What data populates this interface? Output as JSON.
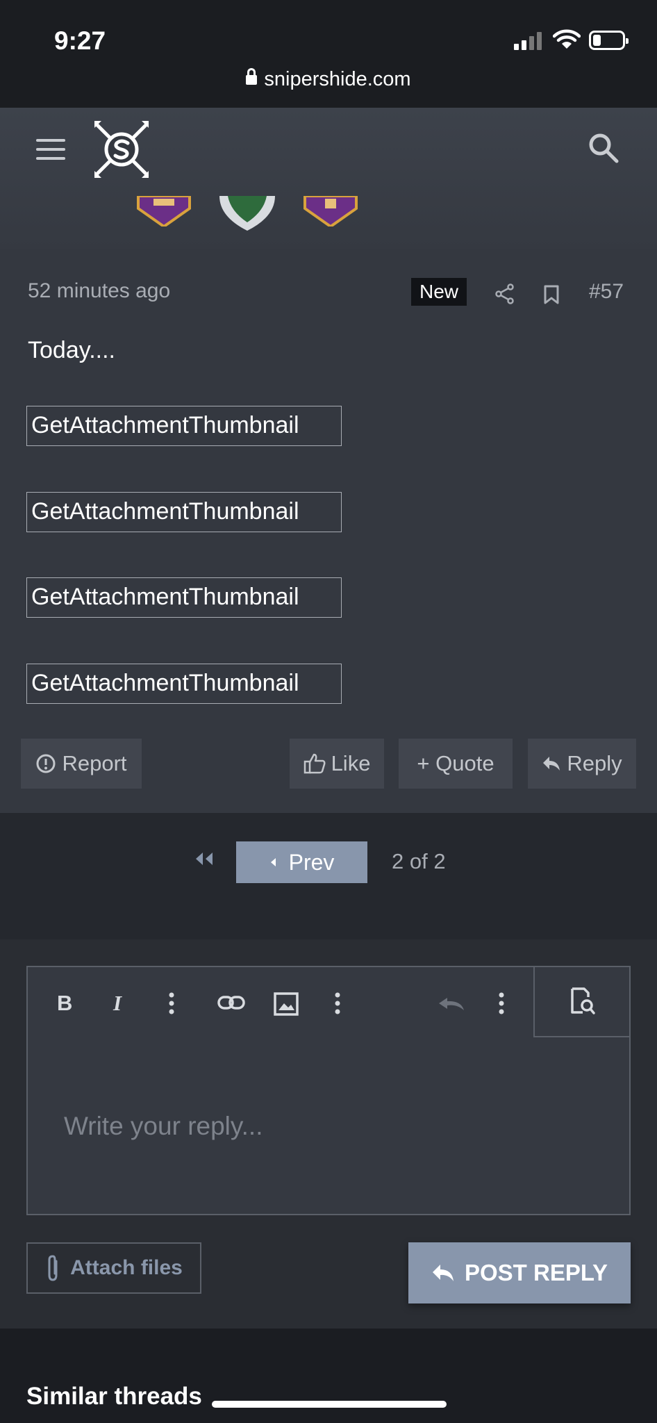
{
  "status_bar": {
    "time": "9:27",
    "url": "snipershide.com"
  },
  "header": {
    "menu_icon": "hamburger-icon",
    "logo": "snipershide-logo",
    "search_icon": "search-icon"
  },
  "post": {
    "time": "52 minutes ago",
    "new_badge": "New",
    "post_number": "#57",
    "body": "Today....",
    "attachments": [
      "GetAttachmentThumbnail",
      "GetAttachmentThumbnail",
      "GetAttachmentThumbnail",
      "GetAttachmentThumbnail"
    ],
    "actions": {
      "report": "Report",
      "like": "Like",
      "quote": "+ Quote",
      "reply": "Reply"
    }
  },
  "pagination": {
    "prev": "Prev",
    "page_info": "2 of 2"
  },
  "reply_form": {
    "placeholder": "Write your reply...",
    "toolbar": {
      "bold": "B",
      "italic": "I"
    },
    "attach_files": "Attach files",
    "post_reply": "POST REPLY"
  },
  "similar": {
    "title": "Similar threads"
  },
  "colors": {
    "accent": "#8896ac",
    "post_bg": "#343840",
    "header_bg": "#3d424b"
  }
}
